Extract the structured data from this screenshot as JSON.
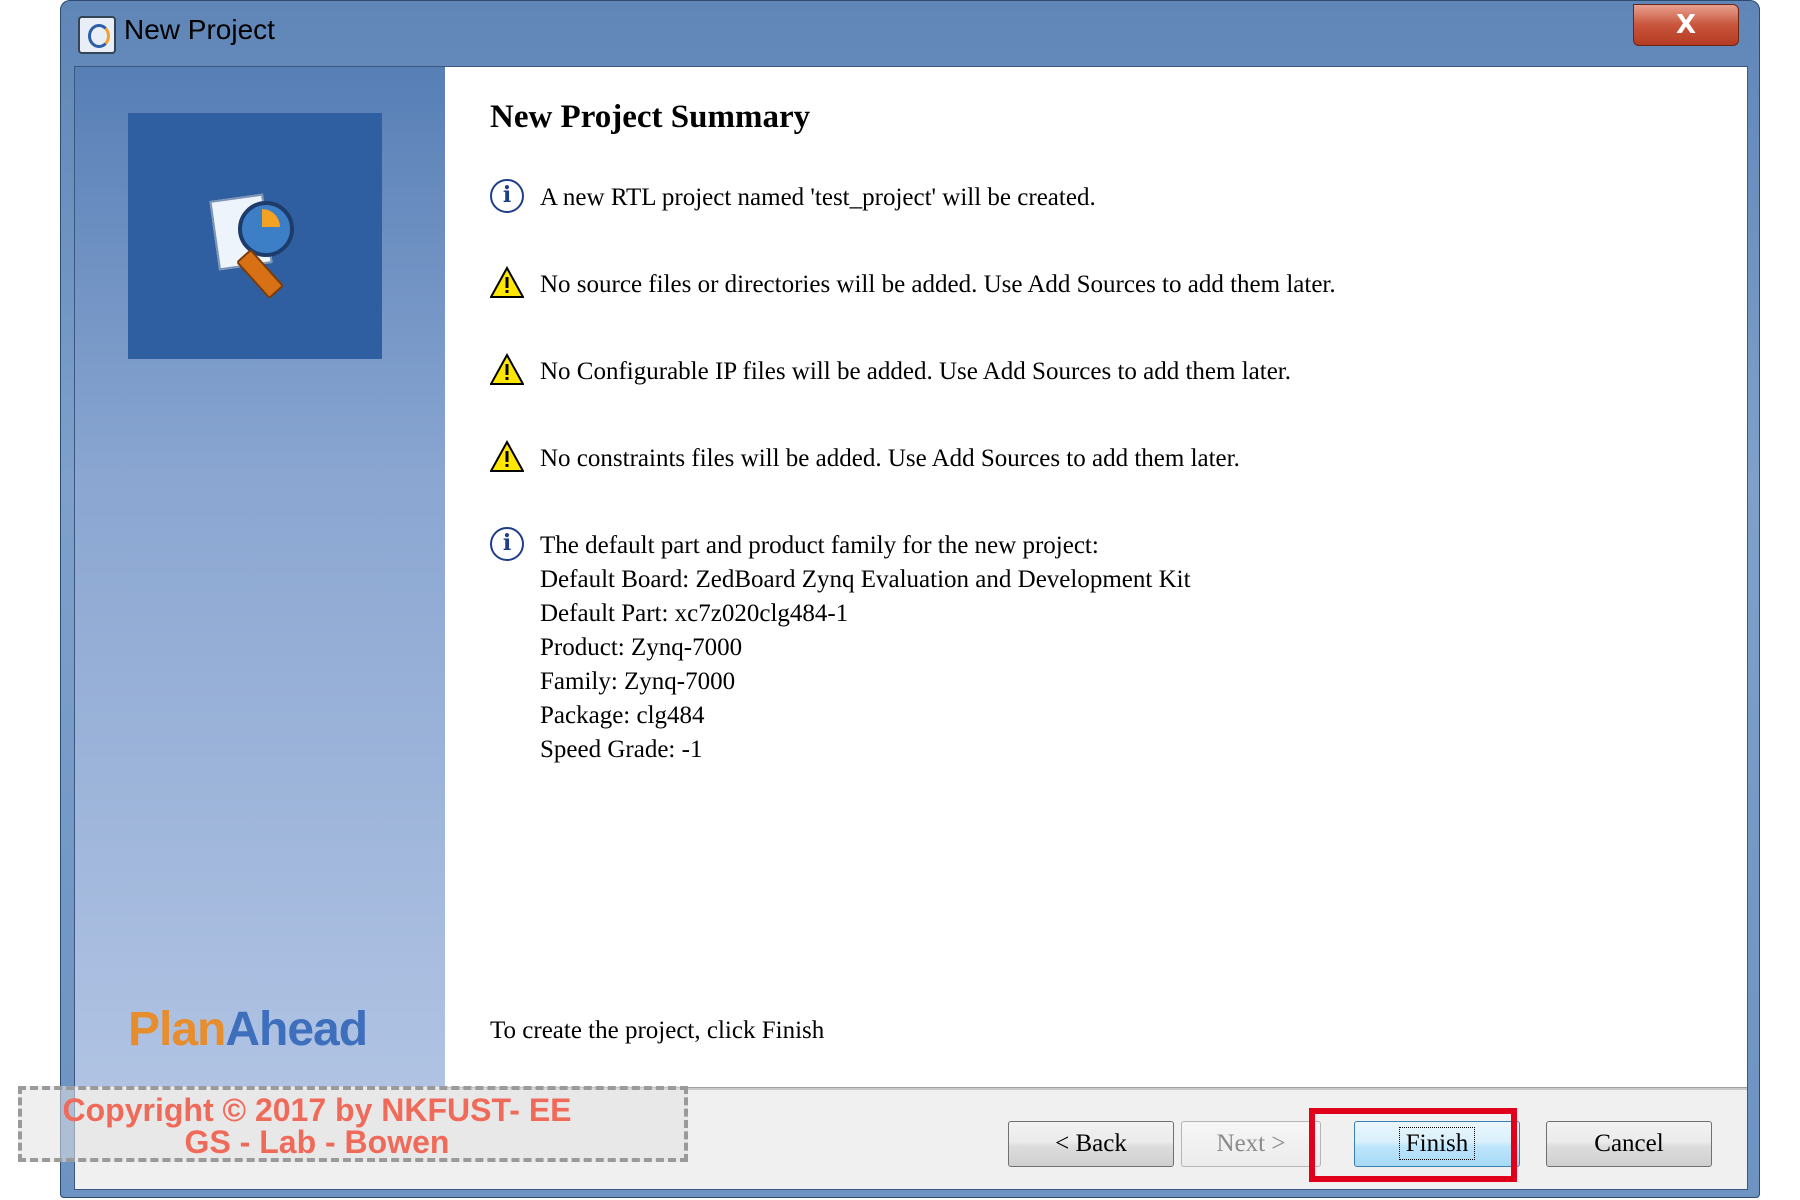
{
  "window": {
    "title": "New Project",
    "close_label": "X"
  },
  "sidebar": {
    "brand_part1": "Plan",
    "brand_part2": "Ahead"
  },
  "main": {
    "heading": "New Project Summary",
    "messages": [
      {
        "icon": "info-icon",
        "text": "A new RTL project named 'test_project' will be created."
      },
      {
        "icon": "warning-icon",
        "text": "No source files or directories will be added. Use Add Sources to add them later."
      },
      {
        "icon": "warning-icon",
        "text": "No Configurable IP files will be added. Use Add Sources to add them later."
      },
      {
        "icon": "warning-icon",
        "text": "No constraints files will be added. Use Add Sources to add them later."
      }
    ],
    "defaults": {
      "icon": "info-icon",
      "intro": "The default part and product family for the new project:",
      "board": "Default Board: ZedBoard Zynq Evaluation and Development Kit",
      "part": "Default Part: xc7z020clg484-1",
      "product": "Product: Zynq-7000",
      "family": "Family: Zynq-7000",
      "package": "Package: clg484",
      "speed": "Speed Grade: -1"
    },
    "footer": "To create the project, click Finish"
  },
  "buttons": {
    "back": "< Back",
    "next": "Next >",
    "finish": "Finish",
    "cancel": "Cancel"
  },
  "watermark": {
    "line1": "Copyright © 2017 by NKFUST- EE",
    "line2": "GS - Lab - Bowen"
  },
  "colors": {
    "highlight": "#e0001b",
    "brand_orange": "#e88d2d",
    "brand_blue": "#3e6fbd"
  }
}
